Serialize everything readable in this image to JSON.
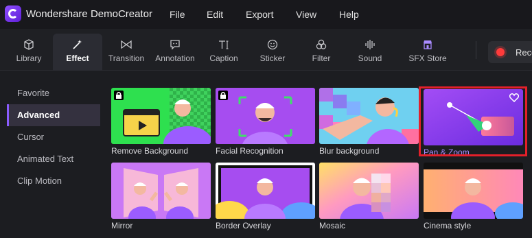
{
  "app": {
    "title": "Wondershare DemoCreator"
  },
  "menu": [
    "File",
    "Edit",
    "Export",
    "View",
    "Help"
  ],
  "toolbar": {
    "tools": [
      {
        "label": "Library",
        "icon": "cube-icon"
      },
      {
        "label": "Effect",
        "icon": "magic-wand-icon"
      },
      {
        "label": "Transition",
        "icon": "bowtie-icon"
      },
      {
        "label": "Annotation",
        "icon": "speech-bubble-icon"
      },
      {
        "label": "Caption",
        "icon": "text-icon"
      },
      {
        "label": "Sticker",
        "icon": "smiley-icon"
      },
      {
        "label": "Filter",
        "icon": "circles-icon"
      },
      {
        "label": "Sound",
        "icon": "waveform-icon"
      },
      {
        "label": "SFX Store",
        "icon": "store-icon"
      }
    ],
    "active": "Effect",
    "record_label": "Reco"
  },
  "sidebar": {
    "items": [
      {
        "label": "Favorite"
      },
      {
        "label": "Advanced"
      },
      {
        "label": "Cursor"
      },
      {
        "label": "Animated Text"
      },
      {
        "label": "Clip Motion"
      }
    ],
    "active": "Advanced"
  },
  "effects": [
    {
      "name": "Remove Background",
      "locked": true
    },
    {
      "name": "Facial Recognition",
      "locked": true
    },
    {
      "name": "Blur background",
      "locked": false
    },
    {
      "name": "Pan & Zoom",
      "locked": false,
      "favorite_icon": "heart-icon",
      "selected": true
    },
    {
      "name": "Mirror",
      "locked": false
    },
    {
      "name": "Border Overlay",
      "locked": false
    },
    {
      "name": "Mosaic",
      "locked": false
    },
    {
      "name": "Cinema style",
      "locked": false
    }
  ],
  "colors": {
    "accent": "#8a5cff",
    "highlight_box": "#e3202a",
    "record": "#ff3b3b",
    "background": "#1c1d21"
  }
}
